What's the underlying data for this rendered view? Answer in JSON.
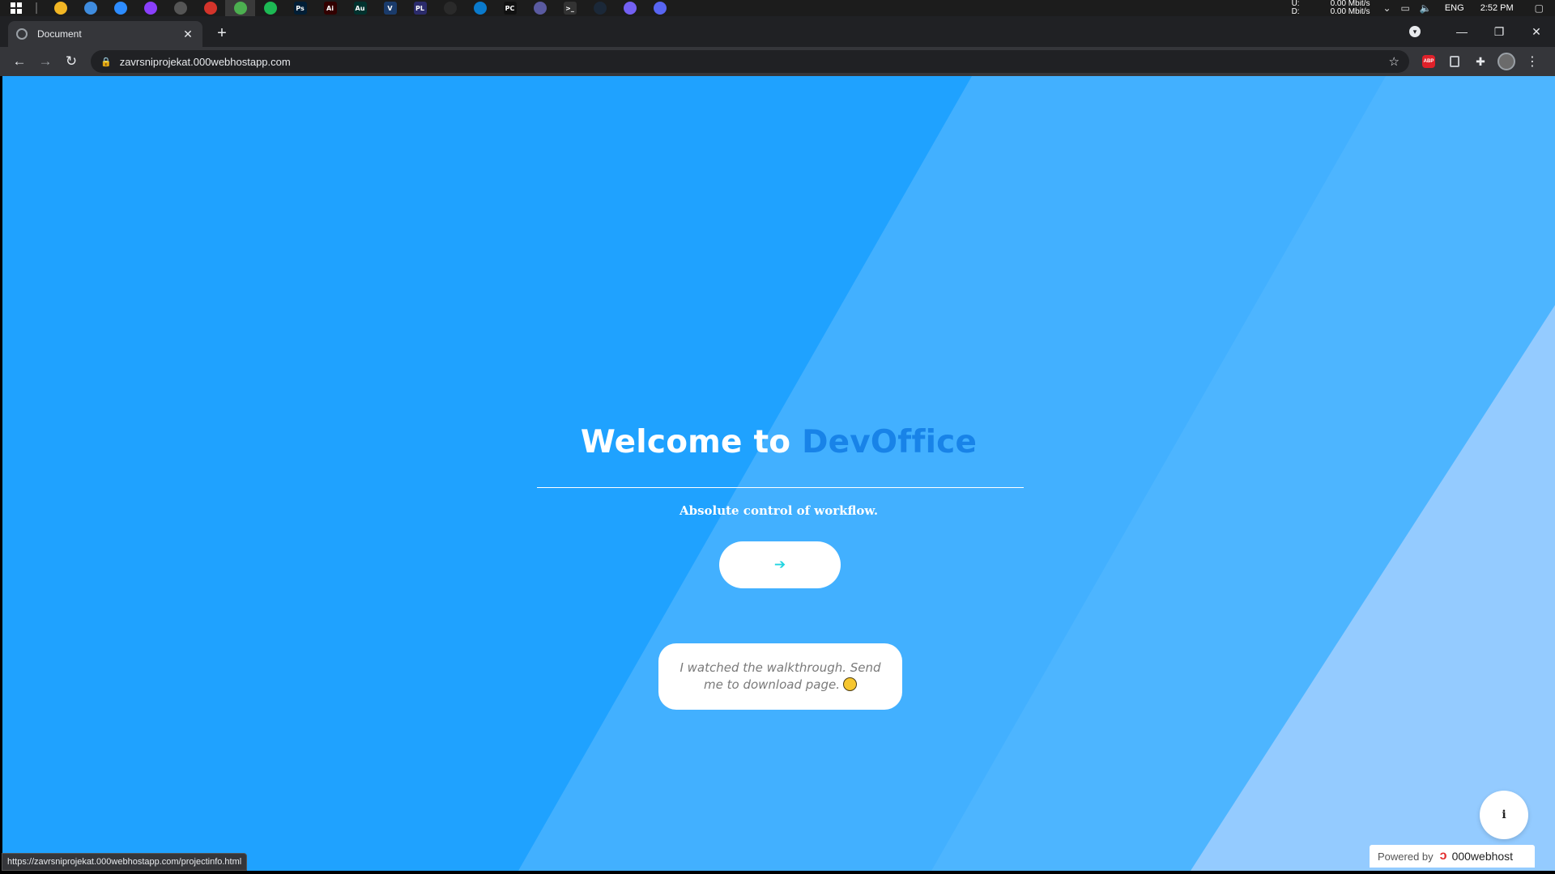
{
  "taskbar": {
    "apps": [
      {
        "icon": "file-explorer-icon",
        "color": "#f2b624",
        "glyph": ""
      },
      {
        "icon": "app-blue-globe-icon",
        "color": "#3f8cde",
        "glyph": ""
      },
      {
        "icon": "zoom-icon",
        "color": "#2d8cff",
        "glyph": ""
      },
      {
        "icon": "messenger-icon",
        "color": "#8a3ffc",
        "glyph": ""
      },
      {
        "icon": "steam-like-gray-icon",
        "color": "#555555",
        "glyph": ""
      },
      {
        "icon": "anydesk-icon",
        "color": "#d4342b",
        "glyph": ""
      },
      {
        "icon": "chrome-icon",
        "color": "#4caf50",
        "glyph": ""
      },
      {
        "icon": "spotify-icon",
        "color": "#1db954",
        "glyph": ""
      },
      {
        "icon": "photoshop-icon",
        "color": "#001e36",
        "glyph": "Ps"
      },
      {
        "icon": "illustrator-icon",
        "color": "#330000",
        "glyph": "Ai"
      },
      {
        "icon": "audition-icon",
        "color": "#00322e",
        "glyph": "Au"
      },
      {
        "icon": "vegas-icon",
        "color": "#1a3b6b",
        "glyph": "V"
      },
      {
        "icon": "pluralsight-icon",
        "color": "#2b2b6b",
        "glyph": "PL"
      },
      {
        "icon": "cursor-app-icon",
        "color": "#2a2a2a",
        "glyph": ""
      },
      {
        "icon": "vscode-icon",
        "color": "#0a7acc",
        "glyph": ""
      },
      {
        "icon": "pycharm-icon",
        "color": "#111111",
        "glyph": "PC"
      },
      {
        "icon": "gaming-app-icon",
        "color": "#5a5aa0",
        "glyph": ""
      },
      {
        "icon": "terminal-icon",
        "color": "#333333",
        "glyph": ">_"
      },
      {
        "icon": "steam-icon",
        "color": "#1b2838",
        "glyph": ""
      },
      {
        "icon": "viber-icon",
        "color": "#7360f2",
        "glyph": ""
      },
      {
        "icon": "discord-icon",
        "color": "#5865f2",
        "glyph": ""
      }
    ],
    "active_app_index": 6,
    "net_upload_label": "U:",
    "net_download_label": "D:",
    "net_upload_value": "0.00 Mbit/s",
    "net_download_value": "0.00 Mbit/s",
    "language": "ENG",
    "time": "2:52 PM"
  },
  "browser": {
    "tab_title": "Document",
    "url": "zavrsniprojekat.000webhostapp.com",
    "status_url": "https://zavrsniprojekat.000webhostapp.com/projectinfo.html"
  },
  "page": {
    "heading_prefix": "Welcome to ",
    "heading_brand": "DevOffice",
    "tagline": "Absolute control of workflow.",
    "go_button_glyph": "➔",
    "walkthrough_text": "I watched the walkthrough. Send me to download page.",
    "info_button_glyph": "i",
    "powered_by": "Powered by",
    "powered_brand": "000webhost"
  },
  "colors": {
    "bg_base": "#1fa2ff",
    "bg_band1": "#42b0ff",
    "bg_band2": "#4db5ff",
    "bg_band3": "#94cbff",
    "brand_blue": "#1883e8",
    "arrow_cyan": "#21d4e0"
  }
}
